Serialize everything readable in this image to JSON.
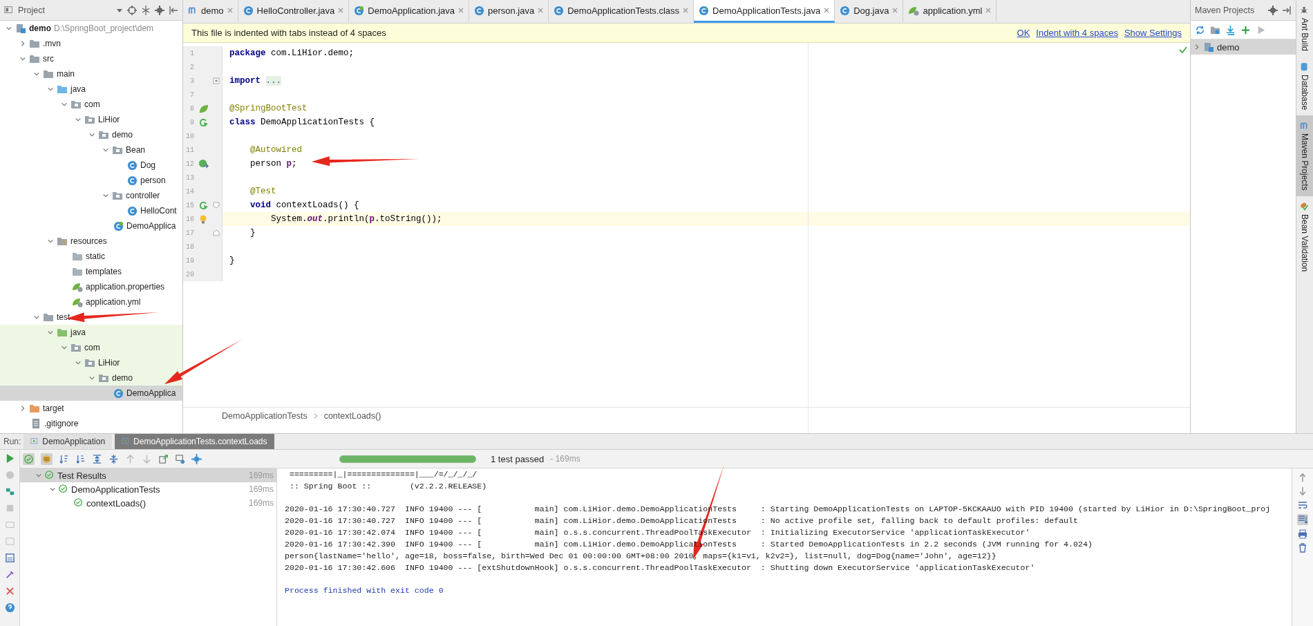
{
  "project_panel": {
    "title": "Project",
    "tree": [
      {
        "label": "demo",
        "path": "D:\\SpringBoot_project\\dem",
        "kind": "module",
        "expanded": true,
        "selected": false,
        "children": [
          {
            "label": ".mvn",
            "kind": "folder",
            "expanded": false,
            "selected": false
          },
          {
            "label": "src",
            "kind": "folder",
            "expanded": true,
            "selected": false,
            "children": [
              {
                "label": "main",
                "kind": "folder",
                "expanded": true,
                "selected": false,
                "children": [
                  {
                    "label": "java",
                    "kind": "source-folder",
                    "expanded": true,
                    "selected": false,
                    "children": [
                      {
                        "label": "com",
                        "kind": "package",
                        "expanded": true,
                        "selected": false,
                        "children": [
                          {
                            "label": "LiHior",
                            "kind": "package",
                            "expanded": true,
                            "selected": false,
                            "children": [
                              {
                                "label": "demo",
                                "kind": "package",
                                "expanded": true,
                                "selected": false,
                                "children": [
                                  {
                                    "label": "Bean",
                                    "kind": "package",
                                    "expanded": true,
                                    "selected": false,
                                    "children": [
                                      {
                                        "label": "Dog",
                                        "kind": "class",
                                        "selected": false
                                      },
                                      {
                                        "label": "person",
                                        "kind": "class",
                                        "selected": false
                                      }
                                    ]
                                  },
                                  {
                                    "label": "controller",
                                    "kind": "package",
                                    "expanded": true,
                                    "selected": false,
                                    "children": [
                                      {
                                        "label": "HelloCont",
                                        "kind": "class",
                                        "selected": false
                                      }
                                    ]
                                  },
                                  {
                                    "label": "DemoApplica",
                                    "kind": "spring-class",
                                    "selected": false
                                  }
                                ]
                              }
                            ]
                          }
                        ]
                      }
                    ]
                  },
                  {
                    "label": "resources",
                    "kind": "resources",
                    "expanded": true,
                    "selected": false,
                    "children": [
                      {
                        "label": "static",
                        "kind": "folder-plain",
                        "selected": false
                      },
                      {
                        "label": "templates",
                        "kind": "folder-plain",
                        "selected": false
                      },
                      {
                        "label": "application.properties",
                        "kind": "config",
                        "selected": false
                      },
                      {
                        "label": "application.yml",
                        "kind": "config",
                        "selected": false
                      }
                    ]
                  }
                ]
              },
              {
                "label": "test",
                "kind": "folder",
                "expanded": true,
                "selected": false,
                "children": [
                  {
                    "label": "java",
                    "kind": "test-folder",
                    "expanded": true,
                    "selected": false,
                    "children": [
                      {
                        "label": "com",
                        "kind": "package",
                        "expanded": true,
                        "selected": false,
                        "children": [
                          {
                            "label": "LiHior",
                            "kind": "package",
                            "expanded": true,
                            "selected": false,
                            "children": [
                              {
                                "label": "demo",
                                "kind": "package",
                                "expanded": true,
                                "selected": false,
                                "children": [
                                  {
                                    "label": "DemoApplica",
                                    "kind": "test-class",
                                    "selected": true
                                  }
                                ]
                              }
                            ]
                          }
                        ]
                      }
                    ]
                  }
                ]
              }
            ]
          },
          {
            "label": "target",
            "kind": "excluded",
            "expanded": false,
            "selected": false
          },
          {
            "label": ".gitignore",
            "kind": "file",
            "selected": false
          }
        ]
      }
    ]
  },
  "editor_tabs": [
    {
      "label": "demo",
      "kind": "maven",
      "selected": false
    },
    {
      "label": "HelloController.java",
      "kind": "class",
      "selected": false
    },
    {
      "label": "DemoApplication.java",
      "kind": "spring-class",
      "selected": false
    },
    {
      "label": "person.java",
      "kind": "class",
      "selected": false
    },
    {
      "label": "DemoApplicationTests.class",
      "kind": "class",
      "selected": false
    },
    {
      "label": "DemoApplicationTests.java",
      "kind": "test-class",
      "selected": true
    },
    {
      "label": "Dog.java",
      "kind": "class",
      "selected": false
    },
    {
      "label": "application.yml",
      "kind": "config",
      "selected": false
    }
  ],
  "notice": {
    "text": "This file is indented with tabs instead of 4 spaces",
    "links": [
      "OK",
      "Indent with 4 spaces",
      "Show Settings"
    ]
  },
  "editor": {
    "lines": [
      {
        "number": "1",
        "current": false,
        "segments": [
          {
            "text": "package",
            "kind": "keyword"
          },
          {
            "text": " com.LiHior.demo;",
            "kind": "plain"
          }
        ]
      },
      {
        "number": "2",
        "current": false
      },
      {
        "number": "3",
        "current": false,
        "fold": {
          "kind": "expand"
        },
        "segments": [
          {
            "text": "import ",
            "kind": "keyword"
          },
          {
            "text": "...",
            "kind": "folded"
          }
        ]
      },
      {
        "number": "7",
        "current": false
      },
      {
        "number": "8",
        "current": false,
        "gutter": {
          "kind": "spring"
        },
        "segments": [
          {
            "text": "@SpringBootTest",
            "kind": "annotation"
          }
        ]
      },
      {
        "number": "9",
        "current": false,
        "gutter": {
          "kind": "run"
        },
        "segments": [
          {
            "text": "class",
            "kind": "keyword"
          },
          {
            "text": " DemoApplicationTests {",
            "kind": "plain"
          }
        ]
      },
      {
        "number": "10",
        "current": false
      },
      {
        "number": "11",
        "current": false,
        "segments": [
          {
            "text": "    @Autowired",
            "kind": "annotation"
          }
        ]
      },
      {
        "number": "12",
        "current": false,
        "gutter": {
          "kind": "bean"
        },
        "segments": [
          {
            "text": "    person ",
            "kind": "plain"
          },
          {
            "text": "p",
            "kind": "var"
          },
          {
            "text": ";",
            "kind": "plain"
          }
        ]
      },
      {
        "number": "13",
        "current": false
      },
      {
        "number": "14",
        "current": false,
        "segments": [
          {
            "text": "    @Test",
            "kind": "annotation"
          }
        ]
      },
      {
        "number": "15",
        "current": false,
        "gutter": {
          "kind": "run"
        },
        "fold": {
          "kind": "start"
        },
        "segments": [
          {
            "text": "    void",
            "kind": "keyword"
          },
          {
            "text": " contextLoads() {",
            "kind": "plain"
          }
        ]
      },
      {
        "number": "16",
        "current": true,
        "gutter": {
          "kind": "bulb"
        },
        "segments": [
          {
            "text": "        System.",
            "kind": "plain"
          },
          {
            "text": "out",
            "kind": "field"
          },
          {
            "text": ".println(",
            "kind": "plain"
          },
          {
            "text": "p",
            "kind": "var"
          },
          {
            "text": ".toString());",
            "kind": "plain"
          }
        ]
      },
      {
        "number": "17",
        "current": false,
        "fold": {
          "kind": "end"
        },
        "segments": [
          {
            "text": "    }",
            "kind": "plain"
          }
        ]
      },
      {
        "number": "18",
        "current": false
      },
      {
        "number": "19",
        "current": false,
        "segments": [
          {
            "text": "}",
            "kind": "plain"
          }
        ]
      },
      {
        "number": "20",
        "current": false
      }
    ]
  },
  "breadcrumb": [
    "DemoApplicationTests",
    "contextLoads()"
  ],
  "maven_panel": {
    "title": "Maven Projects",
    "tree": [
      {
        "label": "demo",
        "expanded": false,
        "selected": true
      }
    ]
  },
  "side_tabs": [
    {
      "label": "Ant Build",
      "kind": "ant",
      "selected": false
    },
    {
      "label": "Database",
      "kind": "database",
      "selected": false
    },
    {
      "label": "Maven Projects",
      "kind": "maven",
      "selected": true
    },
    {
      "label": "Bean Validation",
      "kind": "bean",
      "selected": false
    }
  ],
  "run_panel": {
    "label": "Run:",
    "tabs": [
      {
        "label": "DemoApplication",
        "selected": false
      },
      {
        "label": "DemoApplicationTests.contextLoads",
        "selected": true
      }
    ],
    "progress": {
      "level": 1
    },
    "status": "1 test passed",
    "status_time": "- 169ms",
    "test_tree": [
      {
        "label": "Test Results",
        "time": "169ms",
        "selected": true,
        "children": [
          {
            "label": "DemoApplicationTests",
            "time": "169ms",
            "selected": false,
            "children": [
              {
                "label": "contextLoads()",
                "time": "169ms",
                "selected": false
              }
            ]
          }
        ]
      }
    ],
    "console": [
      {
        "kind": "banner",
        "gap_before": false,
        "text": " =========|_|==============|___/=/_/_/_/"
      },
      {
        "kind": "banner",
        "gap_before": false,
        "text": " :: Spring Boot ::        (v2.2.2.RELEASE)"
      },
      {
        "kind": "log",
        "gap_before": true,
        "text": "2020-01-16 17:30:40.727  INFO 19400 --- [           main] com.LiHior.demo.DemoApplicationTests     : Starting DemoApplicationTests on LAPTOP-5KCKAAUO with PID 19400 (started by LiHior in D:\\SpringBoot_proj"
      },
      {
        "kind": "log",
        "gap_before": false,
        "text": "2020-01-16 17:30:40.727  INFO 19400 --- [           main] com.LiHior.demo.DemoApplicationTests     : No active profile set, falling back to default profiles: default"
      },
      {
        "kind": "log",
        "gap_before": false,
        "text": "2020-01-16 17:30:42.074  INFO 19400 --- [           main] o.s.s.concurrent.ThreadPoolTaskExecutor  : Initializing ExecutorService 'applicationTaskExecutor'"
      },
      {
        "kind": "log",
        "gap_before": false,
        "text": "2020-01-16 17:30:42.390  INFO 19400 --- [           main] com.LiHior.demo.DemoApplicationTests     : Started DemoApplicationTests in 2.2 seconds (JVM running for 4.024)"
      },
      {
        "kind": "log",
        "gap_before": false,
        "text": "person{lastName='hello', age=18, boss=false, birth=Wed Dec 01 00:00:00 GMT+08:00 2010, maps={k1=v1, k2v2=}, list=null, dog=Dog{name='John', age=12}}"
      },
      {
        "kind": "log",
        "gap_before": false,
        "text": "2020-01-16 17:30:42.606  INFO 19400 --- [extShutdownHook] o.s.s.concurrent.ThreadPoolTaskExecutor  : Shutting down ExecutorService 'applicationTaskExecutor'"
      },
      {
        "kind": "system",
        "gap_before": true,
        "text": "Process finished with exit code 0"
      }
    ]
  }
}
